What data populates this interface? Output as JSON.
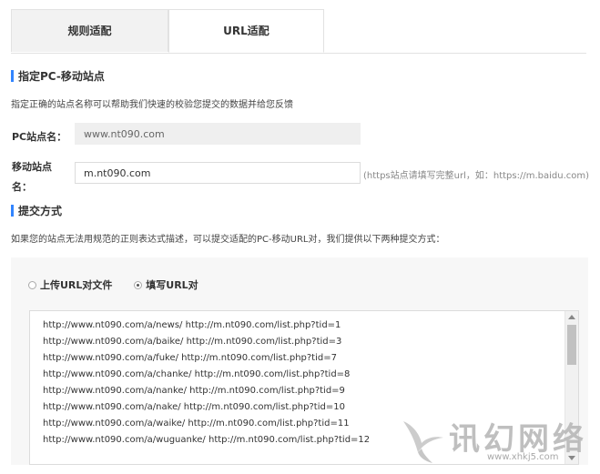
{
  "tabs": [
    {
      "label": "规则适配",
      "active": false
    },
    {
      "label": "URL适配",
      "active": true
    }
  ],
  "section1": {
    "title": "指定PC-移动站点",
    "description": "指定正确的站点名称可以帮助我们快速的校验您提交的数据并给您反馈"
  },
  "form": {
    "pc_label": "PC站点名：",
    "pc_value": "www.nt090.com",
    "mobile_label_line1": "移动站点",
    "mobile_label_line2": "名：",
    "mobile_value": "m.nt090.com",
    "mobile_hint": "(https站点请填写完整url，如：https://m.baidu.com)"
  },
  "section2": {
    "title": "提交方式",
    "description": "如果您的站点无法用规范的正则表达式描述，可以提交适配的PC-移动URL对，我们提供以下两种提交方式："
  },
  "submit_options": [
    {
      "label": "上传URL对文件",
      "selected": false
    },
    {
      "label": "填写URL对",
      "selected": true
    }
  ],
  "url_pairs": [
    "http://www.nt090.com/a/news/ http://m.nt090.com/list.php?tid=1",
    "http://www.nt090.com/a/baike/ http://m.nt090.com/list.php?tid=3",
    "http://www.nt090.com/a/fuke/ http://m.nt090.com/list.php?tid=7",
    "http://www.nt090.com/a/chanke/ http://m.nt090.com/list.php?tid=8",
    "http://www.nt090.com/a/nanke/ http://m.nt090.com/list.php?tid=9",
    "http://www.nt090.com/a/nake/ http://m.nt090.com/list.php?tid=10",
    "http://www.nt090.com/a/waike/ http://m.nt090.com/list.php?tid=11",
    "http://www.nt090.com/a/wuguanke/ http://m.nt090.com/list.php?tid=12"
  ],
  "watermark": {
    "text": "讯幻网络",
    "url": "www.xhkj5.com"
  },
  "colors": {
    "accent": "#3385ff",
    "tab_inactive_bg": "#f2f2f2",
    "panel_bg": "#f7f7f7"
  }
}
